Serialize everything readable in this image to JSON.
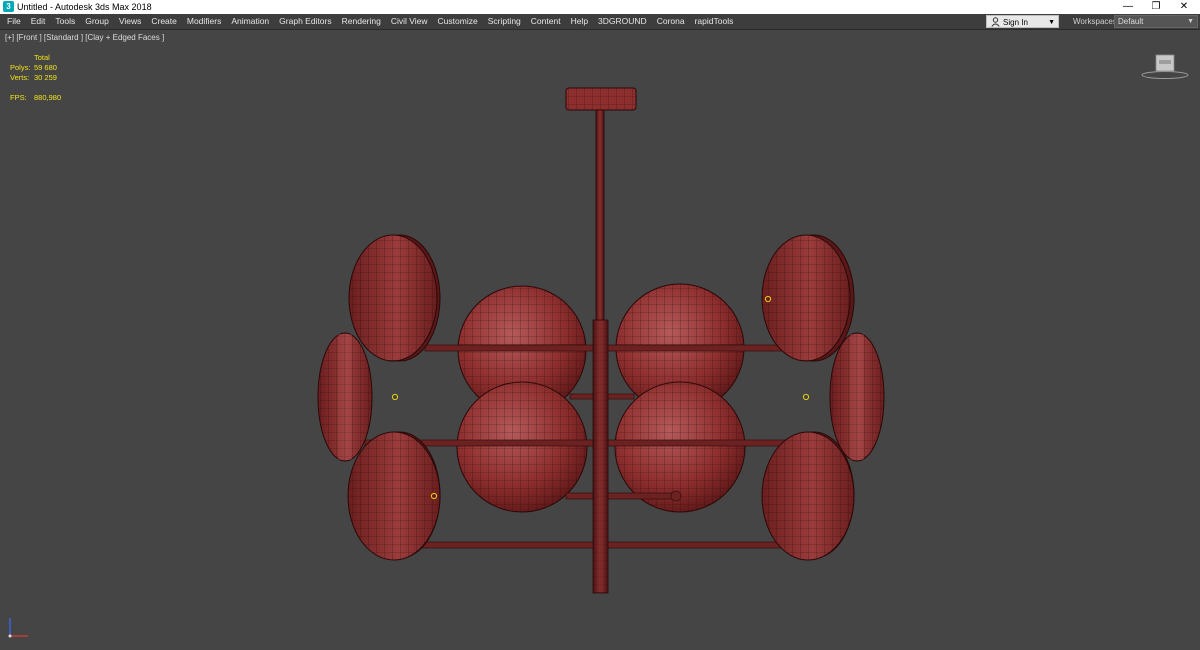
{
  "window": {
    "title": "Untitled - Autodesk 3ds Max 2018",
    "app_icon_letter": "3",
    "controls": {
      "minimize": "—",
      "restore": "❐",
      "close": "✕"
    }
  },
  "menubar": {
    "items": [
      "File",
      "Edit",
      "Tools",
      "Group",
      "Views",
      "Create",
      "Modifiers",
      "Animation",
      "Graph Editors",
      "Rendering",
      "Civil View",
      "Customize",
      "Scripting",
      "Content",
      "Help",
      "3DGROUND",
      "Corona",
      "rapidTools"
    ],
    "sign_in": "Sign In",
    "workspaces_label": "Workspaces:",
    "workspace_value": "Default"
  },
  "viewport": {
    "label": "[+] [Front ] [Standard ] [Clay + Edged Faces ]",
    "stats": {
      "header": "Total",
      "polys_label": "Polys:",
      "polys": "59 680",
      "verts_label": "Verts:",
      "verts": "30 259",
      "fps_label": "FPS:",
      "fps": "880,980"
    },
    "colors": {
      "model": "#8e2f2f",
      "background": "#454545",
      "stats_text": "#f2e31b"
    }
  }
}
